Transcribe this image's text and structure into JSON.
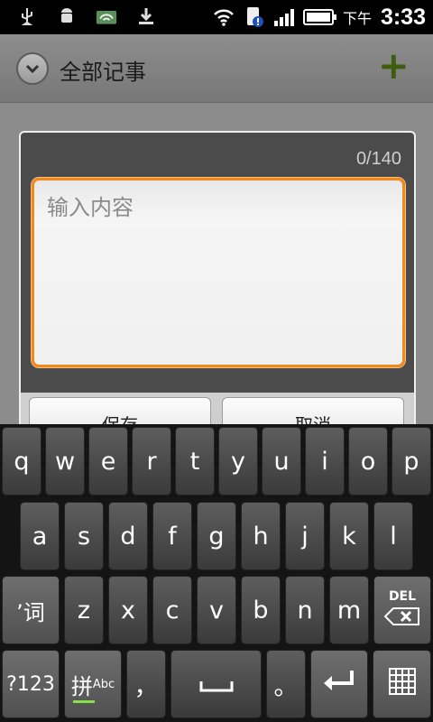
{
  "status_bar": {
    "icons": [
      "usb-icon",
      "android-debug-icon",
      "wifi-folder-icon",
      "download-icon"
    ],
    "ampm": "下午",
    "time": "3:33"
  },
  "header": {
    "title": "全部记事",
    "add_symbol": "+"
  },
  "dialog": {
    "counter": "0/140",
    "input_placeholder": "输入内容",
    "save_label": "保存",
    "cancel_label": "取消"
  },
  "keyboard": {
    "row1": [
      "q",
      "w",
      "e",
      "r",
      "t",
      "y",
      "u",
      "i",
      "o",
      "p"
    ],
    "row2": [
      "a",
      "s",
      "d",
      "f",
      "g",
      "h",
      "j",
      "k",
      "l"
    ],
    "row3": [
      "z",
      "x",
      "c",
      "v",
      "b",
      "n",
      "m"
    ],
    "shift_label": "’词",
    "del_label": "DEL",
    "num_label": "?123",
    "pinyin_label": "拼",
    "pinyin_sub": "Abc",
    "comma_label": "，",
    "period_label": "。"
  }
}
